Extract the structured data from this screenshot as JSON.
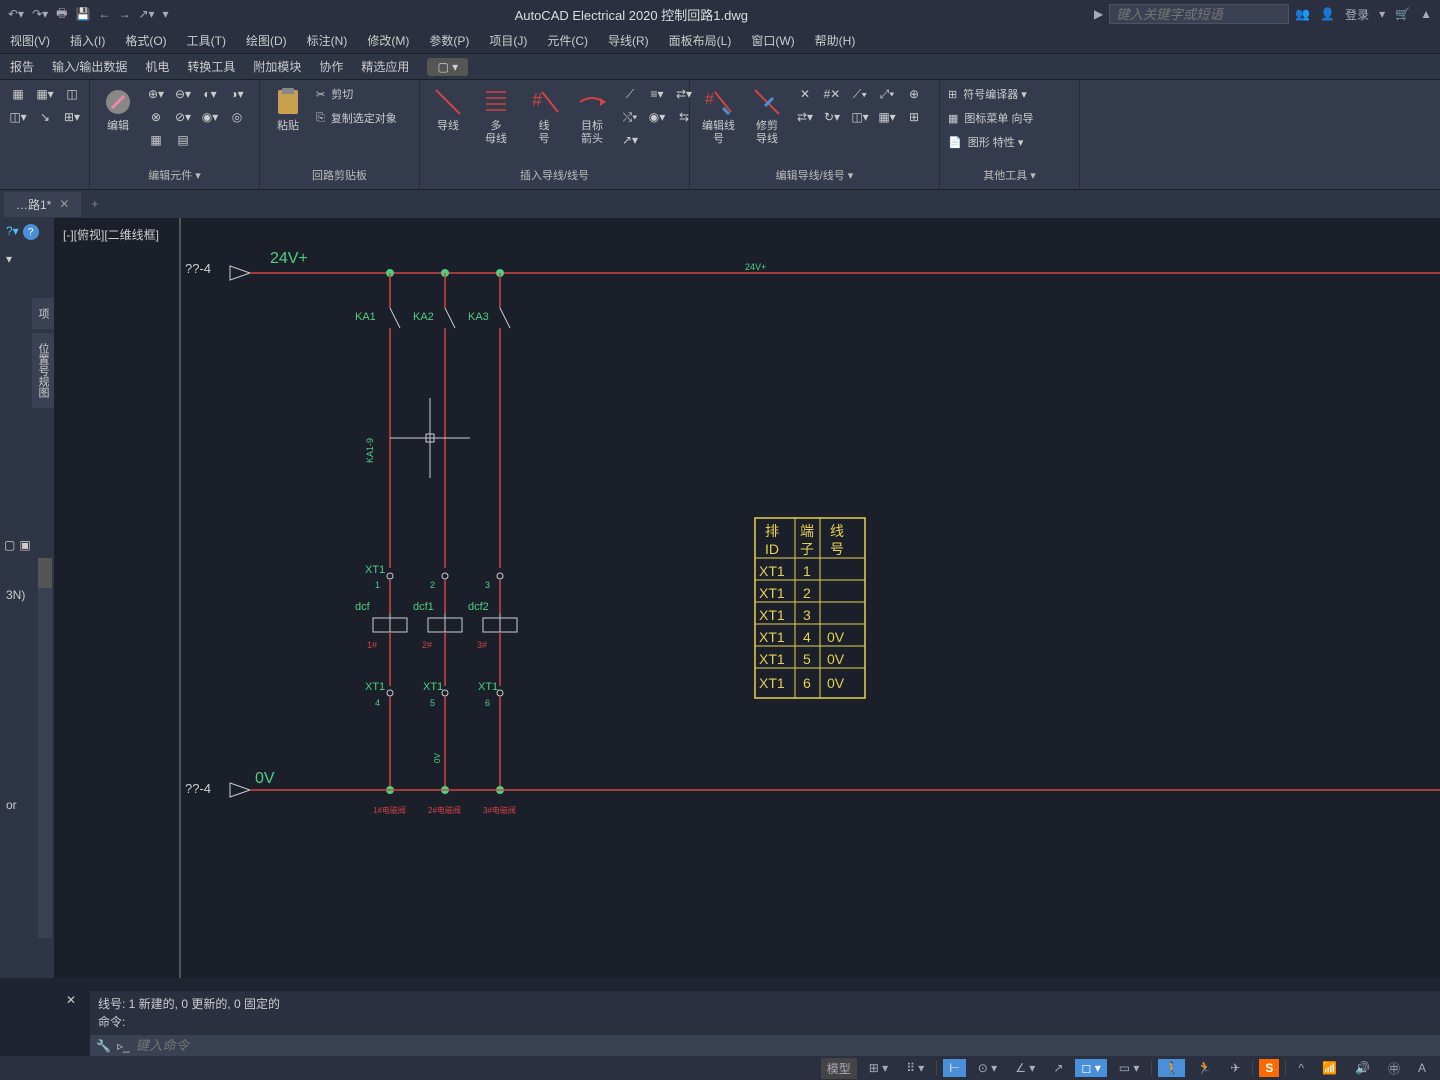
{
  "title": "AutoCAD Electrical 2020    控制回路1.dwg",
  "search_placeholder": "键入关键字或短语",
  "login": "登录",
  "menubar": [
    "视图(V)",
    "插入(I)",
    "格式(O)",
    "工具(T)",
    "绘图(D)",
    "标注(N)",
    "修改(M)",
    "参数(P)",
    "项目(J)",
    "元件(C)",
    "导线(R)",
    "面板布局(L)",
    "窗口(W)",
    "帮助(H)"
  ],
  "ribbon_tabs": [
    "报告",
    "输入/输出数据",
    "机电",
    "转换工具",
    "附加模块",
    "协作",
    "精选应用"
  ],
  "panels": {
    "edit_comp": {
      "label": "编辑元件 ▾",
      "edit": "编辑"
    },
    "clipboard": {
      "label": "回路剪贴板",
      "paste": "粘贴",
      "cut": "剪切",
      "copy": "复制选定对象"
    },
    "insert_wire": {
      "label": "插入导线/线号",
      "wire": "导线",
      "multibus": "多\n母线",
      "wireno": "线\n号",
      "target": "目标\n箭头"
    },
    "edit_wire": {
      "label": "编辑导线/线号 ▾",
      "editwire": "编辑线\n号",
      "trim": "修剪\n导线"
    },
    "other": {
      "label": "其他工具 ▾",
      "symbol": "符号编译器 ▾",
      "icon_menu": "图标菜单 向导",
      "dwg_props": "图形 特性 ▾"
    }
  },
  "doc_tab": "…路1*",
  "viewport": "[-][俯视][二维线框]",
  "side_tabs": [
    "项",
    "位置号规图"
  ],
  "left_text": "3N)",
  "left_text2": "or",
  "drawing": {
    "v24": "24V+",
    "v0": "0V",
    "ref1": "??-4",
    "ref2": "??-4",
    "ka": [
      "KA1",
      "KA2",
      "KA3"
    ],
    "xt_top": "XT1",
    "xt_nums_top": [
      "1",
      "2",
      "3"
    ],
    "dcf": [
      "dcf",
      "dcf1",
      "dcf2"
    ],
    "dcf_red": [
      "1#",
      "2#",
      "3#"
    ],
    "xt_bot": "XT1",
    "xt_nums_bot": [
      "4",
      "5",
      "6"
    ],
    "wire_green": "KA1-9",
    "v24_far": "24V+",
    "bot_red": [
      "1#电磁阀",
      "2#电磁阀",
      "3#电磁阀"
    ],
    "table": {
      "h1": "排\nID",
      "h2": "端\n子",
      "h3": "线\n号",
      "rows": [
        {
          "c1": "XT1",
          "c2": "1",
          "c3": ""
        },
        {
          "c1": "XT1",
          "c2": "2",
          "c3": ""
        },
        {
          "c1": "XT1",
          "c2": "3",
          "c3": ""
        },
        {
          "c1": "XT1",
          "c2": "4",
          "c3": "0V"
        },
        {
          "c1": "XT1",
          "c2": "5",
          "c3": "0V"
        },
        {
          "c1": "XT1",
          "c2": "6",
          "c3": "0V"
        }
      ]
    },
    "ov_green": "0V"
  },
  "cmd_history1": "线号: 1 新建的, 0 更新的, 0 固定的",
  "cmd_history2": "命令:",
  "cmd_placeholder": "键入命令",
  "status": {
    "model": "模型"
  }
}
